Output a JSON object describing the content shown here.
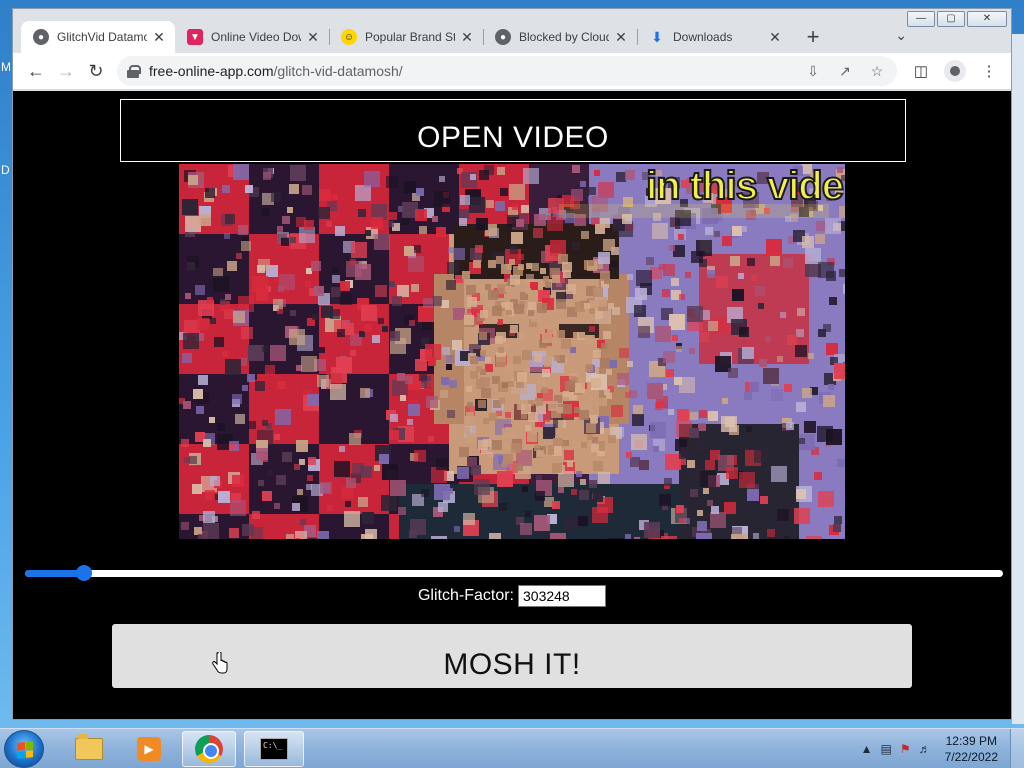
{
  "desktop": {
    "letters": [
      "M",
      "D"
    ]
  },
  "browser": {
    "tabs": [
      {
        "title": "GlitchVid Datamosh",
        "favicon": "globe-icon",
        "active": true
      },
      {
        "title": "Online Video Downloader",
        "favicon": "pink-download-icon",
        "active": false
      },
      {
        "title": "Popular Brand Store",
        "favicon": "yellow-smile-icon",
        "active": false
      },
      {
        "title": "Blocked by Cloudflare",
        "favicon": "globe-icon",
        "active": false
      },
      {
        "title": "Downloads",
        "favicon": "download-icon",
        "active": false
      }
    ],
    "new_tab_label": "+",
    "url_host": "free-online-app.com",
    "url_path": "/glitch-vid-datamosh/"
  },
  "page": {
    "open_video_label": "OPEN VIDEO",
    "video_caption": "in this vide",
    "slider_value": 0.06,
    "glitch_factor_label": "Glitch-Factor:",
    "glitch_factor_value": "303248",
    "mosh_label": "MOSH IT!"
  },
  "taskbar": {
    "time": "12:39 PM",
    "date": "7/22/2022",
    "cmd_text": "C:\\_"
  },
  "colors": {
    "accent": "#1a73e8",
    "caption": "#f3ef4a"
  }
}
